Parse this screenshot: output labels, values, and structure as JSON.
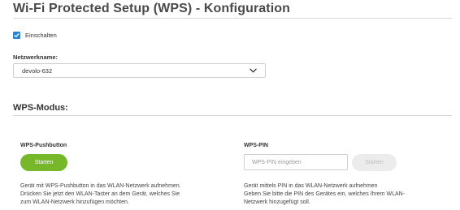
{
  "page": {
    "title": "Wi-Fi Protected Setup (WPS) - Konfiguration"
  },
  "enable": {
    "label": "Einschalten",
    "checked": true
  },
  "network": {
    "label": "Netzwerkname:",
    "selected": "devolo-632"
  },
  "mode": {
    "title": "WPS-Modus:"
  },
  "pushbutton": {
    "title": "WPS-Pushbutton",
    "button_label": "Starten",
    "description_lines": [
      "Gerät mit WPS-Pushbutton in das WLAN-Netzwerk aufnehmen.",
      "Drücken Sie jetzt den WLAN-Taster an dem Gerät, welches Sie",
      "zum WLAN-Netzwerk hinzufügen möchten."
    ]
  },
  "pin": {
    "title": "WPS-PIN",
    "input_placeholder": "WPS-PIN eingeben",
    "button_label": "Starten",
    "description_lines": [
      "Gerät mittels PIN in das WLAN-Netzwerk aufnehmen",
      "Geben Sie bitte die PIN des Gerätes ein, welches Ihrem WLAN-",
      "Netzwerk hinzugefügt soll."
    ]
  },
  "colors": {
    "accent_blue": "#2a84d6",
    "start_green": "#76b82a",
    "disabled_gray": "#ececec"
  }
}
